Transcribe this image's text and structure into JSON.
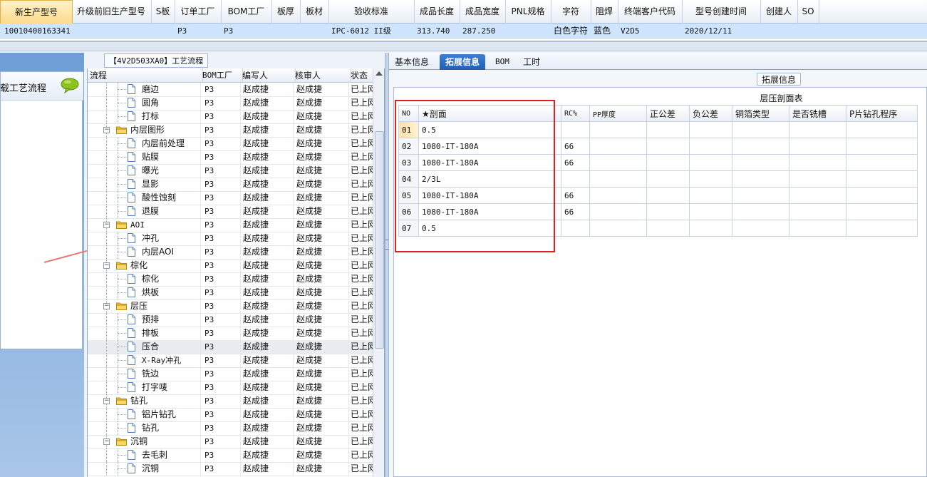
{
  "top_grid": {
    "columns": [
      "新生产型号",
      "升级前旧生产型号",
      "S板",
      "订单工厂",
      "BOM工厂",
      "板厚",
      "板材",
      "验收标准",
      "成品长度",
      "成品宽度",
      "PNL规格",
      "字符",
      "阻焊",
      "终端客户代码",
      "型号创建时间",
      "创建人",
      "SO"
    ],
    "row": [
      "10010400163341",
      "",
      "",
      "P3",
      "P3",
      "",
      "",
      "IPC-6012 II级",
      "313.740",
      "287.250",
      "",
      "白色字符",
      "蓝色",
      "V2D5",
      "2020/12/11",
      "",
      ""
    ]
  },
  "left_panel": {
    "title": "加载工艺流程"
  },
  "mid_panel": {
    "title": "【4V2D503XA0】工艺流程",
    "columns": [
      "流程",
      "BOM工厂",
      "编写人",
      "核审人",
      "状态"
    ],
    "rows": [
      {
        "name": "磨边",
        "level": "step",
        "factory": "P3",
        "writer": "赵成捷",
        "reviewer": "赵成捷",
        "status": "已上网"
      },
      {
        "name": "圆角",
        "level": "step",
        "factory": "P3",
        "writer": "赵成捷",
        "reviewer": "赵成捷",
        "status": "已上网"
      },
      {
        "name": "打标",
        "level": "step",
        "factory": "P3",
        "writer": "赵成捷",
        "reviewer": "赵成捷",
        "status": "已上网"
      },
      {
        "name": "内层图形",
        "level": "group",
        "factory": "P3",
        "writer": "赵成捷",
        "reviewer": "赵成捷",
        "status": "已上网"
      },
      {
        "name": "内层前处理",
        "level": "step",
        "factory": "P3",
        "writer": "赵成捷",
        "reviewer": "赵成捷",
        "status": "已上网"
      },
      {
        "name": "贴膜",
        "level": "step",
        "factory": "P3",
        "writer": "赵成捷",
        "reviewer": "赵成捷",
        "status": "已上网"
      },
      {
        "name": "曝光",
        "level": "step",
        "factory": "P3",
        "writer": "赵成捷",
        "reviewer": "赵成捷",
        "status": "已上网"
      },
      {
        "name": "显影",
        "level": "step",
        "factory": "P3",
        "writer": "赵成捷",
        "reviewer": "赵成捷",
        "status": "已上网"
      },
      {
        "name": "酸性蚀刻",
        "level": "step",
        "factory": "P3",
        "writer": "赵成捷",
        "reviewer": "赵成捷",
        "status": "已上网"
      },
      {
        "name": "退膜",
        "level": "step",
        "factory": "P3",
        "writer": "赵成捷",
        "reviewer": "赵成捷",
        "status": "已上网"
      },
      {
        "name": "AOI",
        "level": "group",
        "factory": "P3",
        "writer": "赵成捷",
        "reviewer": "赵成捷",
        "status": "已上网"
      },
      {
        "name": "冲孔",
        "level": "step",
        "factory": "P3",
        "writer": "赵成捷",
        "reviewer": "赵成捷",
        "status": "已上网"
      },
      {
        "name": "内层AOI",
        "level": "step",
        "factory": "P3",
        "writer": "赵成捷",
        "reviewer": "赵成捷",
        "status": "已上网"
      },
      {
        "name": "棕化",
        "level": "group",
        "factory": "P3",
        "writer": "赵成捷",
        "reviewer": "赵成捷",
        "status": "已上网"
      },
      {
        "name": "棕化",
        "level": "step",
        "factory": "P3",
        "writer": "赵成捷",
        "reviewer": "赵成捷",
        "status": "已上网"
      },
      {
        "name": "烘板",
        "level": "step",
        "factory": "P3",
        "writer": "赵成捷",
        "reviewer": "赵成捷",
        "status": "已上网"
      },
      {
        "name": "层压",
        "level": "group",
        "factory": "P3",
        "writer": "赵成捷",
        "reviewer": "赵成捷",
        "status": "已上网"
      },
      {
        "name": "预排",
        "level": "step",
        "factory": "P3",
        "writer": "赵成捷",
        "reviewer": "赵成捷",
        "status": "已上网"
      },
      {
        "name": "排板",
        "level": "step",
        "factory": "P3",
        "writer": "赵成捷",
        "reviewer": "赵成捷",
        "status": "已上网"
      },
      {
        "name": "压合",
        "level": "step",
        "factory": "P3",
        "writer": "赵成捷",
        "reviewer": "赵成捷",
        "status": "已上网",
        "selected": true
      },
      {
        "name": "X-Ray冲孔",
        "level": "step",
        "factory": "P3",
        "writer": "赵成捷",
        "reviewer": "赵成捷",
        "status": "已上网"
      },
      {
        "name": "铣边",
        "level": "step",
        "factory": "P3",
        "writer": "赵成捷",
        "reviewer": "赵成捷",
        "status": "已上网"
      },
      {
        "name": "打字唛",
        "level": "step",
        "factory": "P3",
        "writer": "赵成捷",
        "reviewer": "赵成捷",
        "status": "已上网"
      },
      {
        "name": "钻孔",
        "level": "group",
        "factory": "P3",
        "writer": "赵成捷",
        "reviewer": "赵成捷",
        "status": "已上网"
      },
      {
        "name": "铝片钻孔",
        "level": "step",
        "factory": "P3",
        "writer": "赵成捷",
        "reviewer": "赵成捷",
        "status": "已上网"
      },
      {
        "name": "钻孔",
        "level": "step",
        "factory": "P3",
        "writer": "赵成捷",
        "reviewer": "赵成捷",
        "status": "已上网"
      },
      {
        "name": "沉铜",
        "level": "group",
        "factory": "P3",
        "writer": "赵成捷",
        "reviewer": "赵成捷",
        "status": "已上网"
      },
      {
        "name": "去毛刺",
        "level": "step",
        "factory": "P3",
        "writer": "赵成捷",
        "reviewer": "赵成捷",
        "status": "已上网"
      },
      {
        "name": "沉铜",
        "level": "step",
        "factory": "P3",
        "writer": "赵成捷",
        "reviewer": "赵成捷",
        "status": "已上网"
      }
    ]
  },
  "right_panel": {
    "tabs": [
      "基本信息",
      "拓展信息",
      "BOM",
      "工时"
    ],
    "active_tab": 1,
    "group_title": "拓展信息",
    "table_title": "层压剖面表",
    "columns": [
      "NO",
      "★剖面",
      "RC%",
      "PP厚度",
      "正公差",
      "负公差",
      "铜箔类型",
      "是否铣槽",
      "P片钻孔程序"
    ],
    "rows": [
      [
        "01",
        "0.5",
        "",
        "",
        "",
        "",
        "",
        "",
        ""
      ],
      [
        "02",
        "1080-IT-180A",
        "66",
        "",
        "",
        "",
        "",
        "",
        ""
      ],
      [
        "03",
        "1080-IT-180A",
        "66",
        "",
        "",
        "",
        "",
        "",
        ""
      ],
      [
        "04",
        "2/3L",
        "",
        "",
        "",
        "",
        "",
        "",
        ""
      ],
      [
        "05",
        "1080-IT-180A",
        "66",
        "",
        "",
        "",
        "",
        "",
        ""
      ],
      [
        "06",
        "1080-IT-180A",
        "66",
        "",
        "",
        "",
        "",
        "",
        ""
      ],
      [
        "07",
        "0.5",
        "",
        "",
        "",
        "",
        "",
        "",
        ""
      ]
    ]
  },
  "colors": {
    "accent": "#1f5fb5",
    "highlight_box": "#e02020",
    "selected_row": "#cfe4ff",
    "folder": "#f2c038"
  }
}
